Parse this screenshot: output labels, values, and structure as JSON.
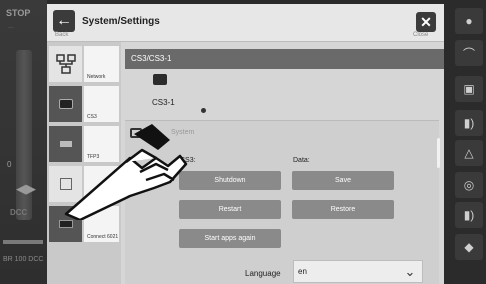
{
  "background": {
    "stop_label": "STOP",
    "stop_sub": "...",
    "speed_zero": "0",
    "dcc_label": "DCC",
    "address_label": "BR 100 DCC"
  },
  "window": {
    "title": "System/Settings",
    "back_label": "Back",
    "close_label": "Close",
    "back_icon": "arrow-left-icon",
    "close_icon": "close-icon"
  },
  "nav": {
    "items": [
      {
        "label": "Network",
        "icon": "network-icon"
      },
      {
        "label": "CS3",
        "icon": "cs3-device-icon"
      },
      {
        "label": "TFP3",
        "icon": "tfp3-icon"
      },
      {
        "label": "",
        "icon": "user-list-icon"
      },
      {
        "label": "Connect 6021",
        "icon": "connect-6021-icon"
      }
    ]
  },
  "device": {
    "bar_label": "CS3/CS3-1",
    "name": "CS3-1"
  },
  "system": {
    "section_label": "System",
    "cs3_label": "CS3:",
    "data_label": "Data:",
    "shutdown": "Shutdown",
    "restart": "Restart",
    "start_apps": "Start apps again",
    "save": "Save",
    "restore": "Restore"
  },
  "language": {
    "label": "Language",
    "value": "en"
  },
  "colors": {
    "button_bg": "#8a8a8a",
    "dark_bar": "#6a6a6a"
  }
}
